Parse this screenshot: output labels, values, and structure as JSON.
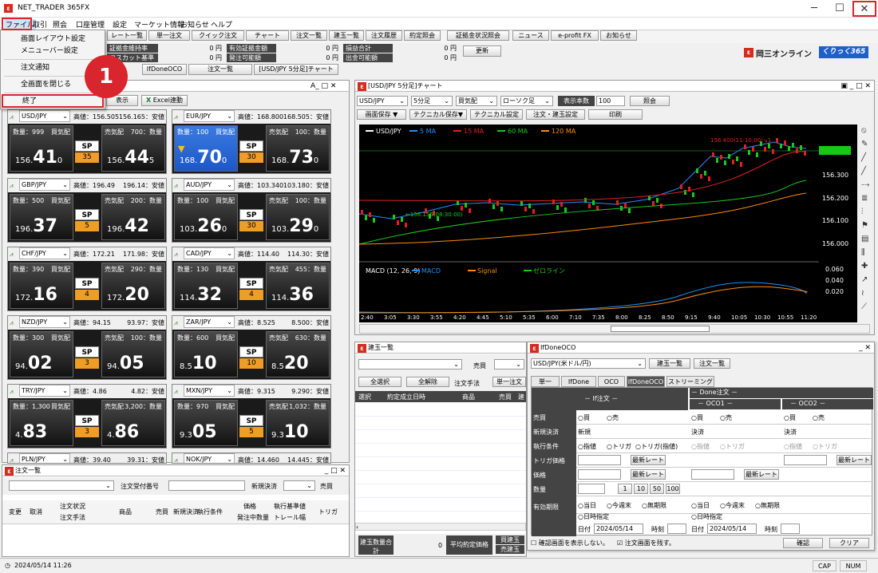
{
  "app": {
    "title": "NET_TRADER 365FX"
  },
  "menubar": [
    "ファイル",
    "取引",
    "照会",
    "口座管理",
    "設定",
    "マーケット情報",
    "お知らせ",
    "ヘルプ"
  ],
  "file_menu": {
    "items": [
      "画面レイアウト設定",
      "メニューバー設定",
      "注文通知",
      "全画面を閉じる",
      "終了"
    ]
  },
  "callout": "1",
  "toolbar": {
    "row1": [
      "レート一覧",
      "単一注文",
      "クイック注文",
      "チャート",
      "注文一覧",
      "建玉一覧",
      "注文履歴",
      "約定照会",
      "証拠金状況照会",
      "ニュース",
      "e-profit FX",
      "お知らせ"
    ],
    "info": [
      {
        "label": "証拠金維持率",
        "value": "0 円"
      },
      {
        "label": "ロスカット基準額",
        "value": "0 円"
      },
      {
        "label": "有効証拠金額",
        "value": "0 円"
      },
      {
        "label": "発注可能額",
        "value": "0 円"
      },
      {
        "label": "損益合計",
        "value": "0 円"
      },
      {
        "label": "出金可能額",
        "value": "0 円"
      }
    ],
    "update": "更新"
  },
  "tabs": [
    "IfDoneOCO",
    "注文一覧",
    "[USD/JPY 5分足]チャート"
  ],
  "brand": {
    "name": "岡三オンライン",
    "badge": "くりっく365"
  },
  "rate_panel": {
    "display": "表示",
    "excel": "Excel連動",
    "tiles": [
      {
        "pair": "USD/JPY",
        "hl": "高値：156.505",
        "lo": "156.165：安値",
        "qty_bid": "数量：999",
        "bid_lbl": "買気配",
        "ask_lbl": "売気配",
        "qty_ask": "700：数量",
        "bid_pre": "156.",
        "bid_big": "41",
        "bid_sub": "0",
        "ask_pre": "156.",
        "ask_big": "44",
        "ask_sub": "5",
        "sp": "35"
      },
      {
        "pair": "EUR/JPY",
        "hl": "高値：168.800",
        "lo": "168.505：安値",
        "qty_bid": "数量：100",
        "bid_lbl": "買気配",
        "ask_lbl": "売気配",
        "qty_ask": "100：数量",
        "bid_pre": "168.",
        "bid_big": "70",
        "bid_sub": "0",
        "ask_pre": "168.",
        "ask_big": "73",
        "ask_sub": "0",
        "sp": "30"
      },
      {
        "pair": "GBP/JPY",
        "hl": "高値：196.49",
        "lo": "196.14：安値",
        "qty_bid": "数量：500",
        "bid_lbl": "買気配",
        "ask_lbl": "売気配",
        "qty_ask": "200：数量",
        "bid_pre": "196.",
        "bid_big": "37",
        "bid_sub": "",
        "ask_pre": "196.",
        "ask_big": "42",
        "ask_sub": "",
        "sp": "5"
      },
      {
        "pair": "AUD/JPY",
        "hl": "高値：103.340",
        "lo": "103.180：安値",
        "qty_bid": "数量：100",
        "bid_lbl": "買気配",
        "ask_lbl": "売気配",
        "qty_ask": "100：数量",
        "bid_pre": "103.",
        "bid_big": "26",
        "bid_sub": "0",
        "ask_pre": "103.",
        "ask_big": "29",
        "ask_sub": "0",
        "sp": "30"
      },
      {
        "pair": "CHF/JPY",
        "hl": "高値：172.21",
        "lo": "171.98：安値",
        "qty_bid": "数量：390",
        "bid_lbl": "買気配",
        "ask_lbl": "売気配",
        "qty_ask": "290：数量",
        "bid_pre": "172.",
        "bid_big": "16",
        "bid_sub": "",
        "ask_pre": "172.",
        "ask_big": "20",
        "ask_sub": "",
        "sp": "4"
      },
      {
        "pair": "CAD/JPY",
        "hl": "高値：114.40",
        "lo": "114.30：安値",
        "qty_bid": "数量：130",
        "bid_lbl": "買気配",
        "ask_lbl": "売気配",
        "qty_ask": "455：数量",
        "bid_pre": "114.",
        "bid_big": "32",
        "bid_sub": "",
        "ask_pre": "114.",
        "ask_big": "36",
        "ask_sub": "",
        "sp": "4"
      },
      {
        "pair": "NZD/JPY",
        "hl": "高値：94.15",
        "lo": "93.97：安値",
        "qty_bid": "数量：300",
        "bid_lbl": "買気配",
        "ask_lbl": "売気配",
        "qty_ask": "100：数量",
        "bid_pre": "94.",
        "bid_big": "02",
        "bid_sub": "",
        "ask_pre": "94.",
        "ask_big": "05",
        "ask_sub": "",
        "sp": "3"
      },
      {
        "pair": "ZAR/JPY",
        "hl": "高値：8.525",
        "lo": "8.500：安値",
        "qty_bid": "数量：600",
        "bid_lbl": "買気配",
        "ask_lbl": "売気配",
        "qty_ask": "630：数量",
        "bid_pre": "8.5",
        "bid_big": "10",
        "bid_sub": "",
        "ask_pre": "8.5",
        "ask_big": "20",
        "ask_sub": "",
        "sp": "10"
      },
      {
        "pair": "TRY/JPY",
        "hl": "高値：4.86",
        "lo": "4.82：安値",
        "qty_bid": "数量：1,300",
        "bid_lbl": "買気配",
        "ask_lbl": "売気配",
        "qty_ask": "3,200：数量",
        "bid_pre": "4.",
        "bid_big": "83",
        "bid_sub": "",
        "ask_pre": "4.",
        "ask_big": "86",
        "ask_sub": "",
        "sp": "3"
      },
      {
        "pair": "MXN/JPY",
        "hl": "高値：9.315",
        "lo": "9.290：安値",
        "qty_bid": "数量：970",
        "bid_lbl": "買気配",
        "ask_lbl": "売気配",
        "qty_ask": "1,032：数量",
        "bid_pre": "9.3",
        "bid_big": "05",
        "bid_sub": "",
        "ask_pre": "9.3",
        "ask_big": "10",
        "ask_sub": "",
        "sp": "5"
      },
      {
        "pair": "PLN/JPY",
        "hl": "高値：39.40",
        "lo": "39.31：安値"
      },
      {
        "pair": "NOK/JPY",
        "hl": "高値：14.460",
        "lo": "14.445：安値"
      }
    ]
  },
  "chart": {
    "title": "[USD/JPY 5分足]チャート",
    "pair": "USD/JPY",
    "period": "5分足",
    "side": "買気配",
    "candle": "ローソク足",
    "count_lbl": "表示本数",
    "count": "100",
    "query": "照会",
    "btns": [
      "画面保存 ▼",
      "テクニカル保存▼",
      "テクニカル設定",
      "注文・建玉設定",
      "印刷"
    ],
    "legend": [
      "USD/JPY",
      "5 MA",
      "15 MA",
      "60 MA",
      "120 MA"
    ],
    "yticks": [
      "156.410",
      "156.300",
      "156.200",
      "156.100",
      "156.000"
    ],
    "hi_label": "156.400(11:10:00)↘1",
    "lo_label": "←156.155(08:30:00)",
    "macd_legend": [
      "MACD (12, 26, 9)",
      "MACD",
      "Signal",
      "ゼロライン"
    ],
    "macd_y": [
      "0.060",
      "0.040",
      "0.020"
    ],
    "xticks": [
      "2:40",
      "3:05",
      "3:30",
      "3:55",
      "4:20",
      "4:45",
      "5:10",
      "5:35",
      "6:00",
      "7:10",
      "7:35",
      "8:00",
      "8:25",
      "8:50",
      "9:15",
      "9:40",
      "10:05",
      "10:30",
      "10:55",
      "11:20"
    ]
  },
  "positions": {
    "title": "建玉一覧",
    "side": "売買",
    "select_all": "全選択",
    "clear_all": "全解除",
    "note": "注文手法",
    "single": "単一注文",
    "cols": [
      "選択",
      "約定成立日時",
      "商品",
      "売買",
      "建"
    ],
    "footer": [
      "建玉数量合計",
      "0",
      "平均約定価格",
      "買建玉",
      "売建玉"
    ]
  },
  "ifdone": {
    "title": "IfDoneOCO",
    "pair": "USD/JPY(米ドル/円)",
    "btn1": "建玉一覧",
    "btn2": "注文一覧",
    "tabs": [
      "単一",
      "IfDone",
      "OCO",
      "IfDoneOCO",
      "ストリーミング"
    ],
    "if_head": "－ If注文 －",
    "done_head": "－ Done注文 －",
    "oco1": "－ OCO1 －",
    "oco2": "－ OCO2 －",
    "rows": [
      "売買",
      "新規決済",
      "執行条件",
      "トリガ価格",
      "価格",
      "数量",
      "有効期限"
    ],
    "buy": "買",
    "sell": "売",
    "new": "新規",
    "settle": "決済",
    "limit": "指値",
    "trigger": "トリガ",
    "trigger_limit": "トリガ(指値)",
    "latest": "最新レート",
    "qty_btns": [
      "1",
      "10",
      "50",
      "100"
    ],
    "today": "当日",
    "week": "今週末",
    "nolimit": "無期限",
    "dated": "日時指定",
    "date_lbl": "日付",
    "date": "2024/05/14",
    "time_lbl": "時刻",
    "confirm_chk": "確認画面を表示しない。",
    "keep_chk": "注文画面を残す。",
    "confirm": "確認",
    "clear": "クリア"
  },
  "orders": {
    "title": "注文一覧",
    "recv": "注文受付番号",
    "settle": "新規決済",
    "side": "売買",
    "cols": [
      "変更",
      "取消",
      "注文状況",
      "注文手法",
      "商品",
      "売買",
      "新規決済",
      "執行条件",
      "価格",
      "発注中数量",
      "執行基準値",
      "トレール幅",
      "トリガ"
    ]
  },
  "status": {
    "time": "2024/05/14 11:26",
    "cap": "CAP",
    "num": "NUM"
  }
}
